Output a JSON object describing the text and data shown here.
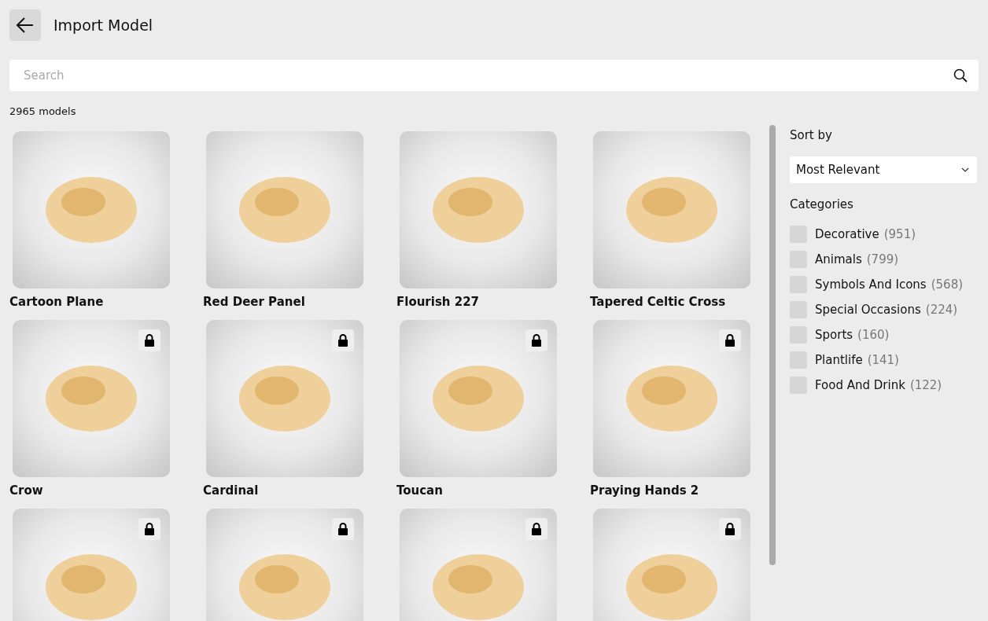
{
  "header": {
    "title": "Import Model"
  },
  "search": {
    "placeholder": "Search"
  },
  "model_count": "2965 models",
  "models": [
    {
      "name": "Cartoon Plane",
      "locked": false
    },
    {
      "name": "Red Deer Panel",
      "locked": false
    },
    {
      "name": "Flourish 227",
      "locked": false
    },
    {
      "name": "Tapered Celtic Cross",
      "locked": false
    },
    {
      "name": "Crow",
      "locked": true
    },
    {
      "name": "Cardinal",
      "locked": true
    },
    {
      "name": "Toucan",
      "locked": true
    },
    {
      "name": "Praying Hands 2",
      "locked": true
    },
    {
      "locked": true
    },
    {
      "locked": true
    },
    {
      "locked": true
    },
    {
      "locked": true
    }
  ],
  "sidebar": {
    "sort_label": "Sort by",
    "sort_value": "Most Relevant",
    "categories_label": "Categories",
    "categories": [
      {
        "name": "Decorative",
        "count": "(951)",
        "checked": false
      },
      {
        "name": "Animals",
        "count": "(799)",
        "checked": false
      },
      {
        "name": "Symbols And Icons",
        "count": "(568)",
        "checked": false
      },
      {
        "name": "Special Occasions",
        "count": "(224)",
        "checked": false
      },
      {
        "name": "Sports",
        "count": "(160)",
        "checked": false
      },
      {
        "name": "Plantlife",
        "count": "(141)",
        "checked": false
      },
      {
        "name": "Food And Drink",
        "count": "(122)",
        "checked": false
      }
    ]
  }
}
